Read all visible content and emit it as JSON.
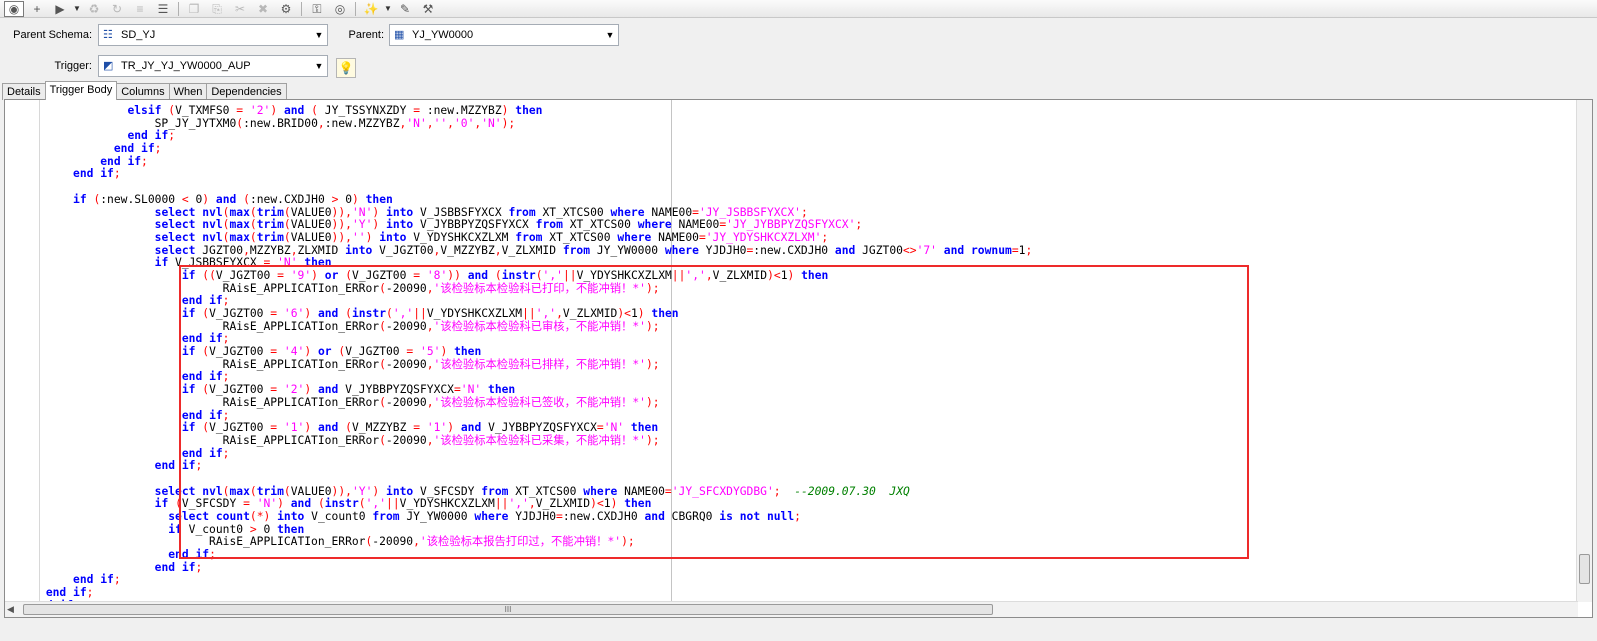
{
  "toolbar": {
    "icons": [
      "record-icon",
      "add-icon",
      "run-icon",
      "dropdown-arrow",
      "recycle-icon",
      "refresh-icon",
      "sql-icon",
      "stack-icon",
      "copy-icon",
      "paste-icon",
      "cut-icon",
      "clear-icon",
      "compile-icon",
      "key-icon",
      "binoculars-icon",
      "wand-icon",
      "dropdown-arrow",
      "notes-icon",
      "settings-icon"
    ]
  },
  "fields": {
    "parent_schema_label": "Parent Schema:",
    "parent_schema_value": "SD_YJ",
    "parent_label": "Parent:",
    "parent_value": "YJ_YW0000",
    "trigger_label": "Trigger:",
    "trigger_value": "TR_JY_YJ_YW0000_AUP"
  },
  "tabs": [
    {
      "label": "Details",
      "active": false
    },
    {
      "label": "Trigger Body",
      "active": true
    },
    {
      "label": "Columns",
      "active": false
    },
    {
      "label": "When",
      "active": false
    },
    {
      "label": "Dependencies",
      "active": false
    }
  ],
  "code_lines": [
    "                  elsif (V_TXMFS0 = '2') and ( JY_TSSYNXZDY = :new.MZZYBZ) then",
    "                      SP_JY_JYTXM0(:new.BRID00,:new.MZZYBZ,'N','','0','N');",
    "                  end if;",
    "                end if;",
    "              end if;",
    "          end if;",
    "",
    "          if (:new.SL0000 < 0) and (:new.CXDJH0 > 0) then",
    "                      select nvl(max(trim(VALUE0)),'N') into V_JSBBSFYXCX from XT_XTCS00 where NAME00='JY_JSBBSFYXCX';",
    "                      select nvl(max(trim(VALUE0)),'Y') into V_JYBBPYZQSFYXCX from XT_XTCS00 where NAME00='JY_JYBBPYZQSFYXCX';",
    "                      select nvl(max(trim(VALUE0)),'') into V_YDYSHKCXZLXM from XT_XTCS00 where NAME00='JY_YDYSHKCXZLXM';",
    "                      select JGZT00,MZZYBZ,ZLXMID into V_JGZT00,V_MZZYBZ,V_ZLXMID from JY_YW0000 where YJDJH0=:new.CXDJH0 and JGZT00<>'7' and rownum=1;",
    "                      if V_JSBBSFYXCX = 'N' then",
    "                          if ((V_JGZT00 = '9') or (V_JGZT00 = '8')) and (instr(','||V_YDYSHKCXZLXM||',',V_ZLXMID)<1) then",
    "                                RAisE_APPLICATIon_ERRor(-20090,'该检验标本检验科已打印，不能冲销！*');",
    "                          end if;",
    "                          if (V_JGZT00 = '6') and (instr(','||V_YDYSHKCXZLXM||',',V_ZLXMID)<1) then",
    "                                RAisE_APPLICATIon_ERRor(-20090,'该检验标本检验科已审核，不能冲销！*');",
    "                          end if;",
    "                          if (V_JGZT00 = '4') or (V_JGZT00 = '5') then",
    "                                RAisE_APPLICATIon_ERRor(-20090,'该检验标本检验科已排样，不能冲销！*');",
    "                          end if;",
    "                          if (V_JGZT00 = '2') and V_JYBBPYZQSFYXCX='N' then",
    "                                RAisE_APPLICATIon_ERRor(-20090,'该检验标本检验科已签收，不能冲销！*');",
    "                          end if;",
    "                          if (V_JGZT00 = '1') and (V_MZZYBZ = '1') and V_JYBBPYZQSFYXCX='N' then",
    "                                RAisE_APPLICATIon_ERRor(-20090,'该检验标本检验科已采集，不能冲销！*');",
    "                          end if;",
    "                      end if;",
    "",
    "                      select nvl(max(trim(VALUE0)),'Y') into V_SFCSDY from XT_XTCS00 where NAME00='JY_SFCXDYGDBG';  --2009.07.30  JXQ",
    "                      if (V_SFCSDY = 'N') and (instr(','||V_YDYSHKCXZLXM||',',V_ZLXMID)<1) then",
    "                        select count(*) into V_count0 from JY_YW0000 where YJDJH0=:new.CXDJH0 and CBGRQ0 is not null;",
    "                        if V_count0 > 0 then",
    "                              RAisE_APPLICATIon_ERRor(-20090,'该检验标本报告打印过，不能冲销！*');",
    "                        end if;",
    "                      end if;",
    "          end if;",
    "      end if;",
    "    end if;",
    "  exception"
  ],
  "colors": {
    "keyword": "#0000ff",
    "string": "#ff00ff",
    "operator": "#ff0000",
    "comment": "#008000",
    "highlight_box": "#ee2a2a"
  },
  "scrollbar_grip": "III"
}
